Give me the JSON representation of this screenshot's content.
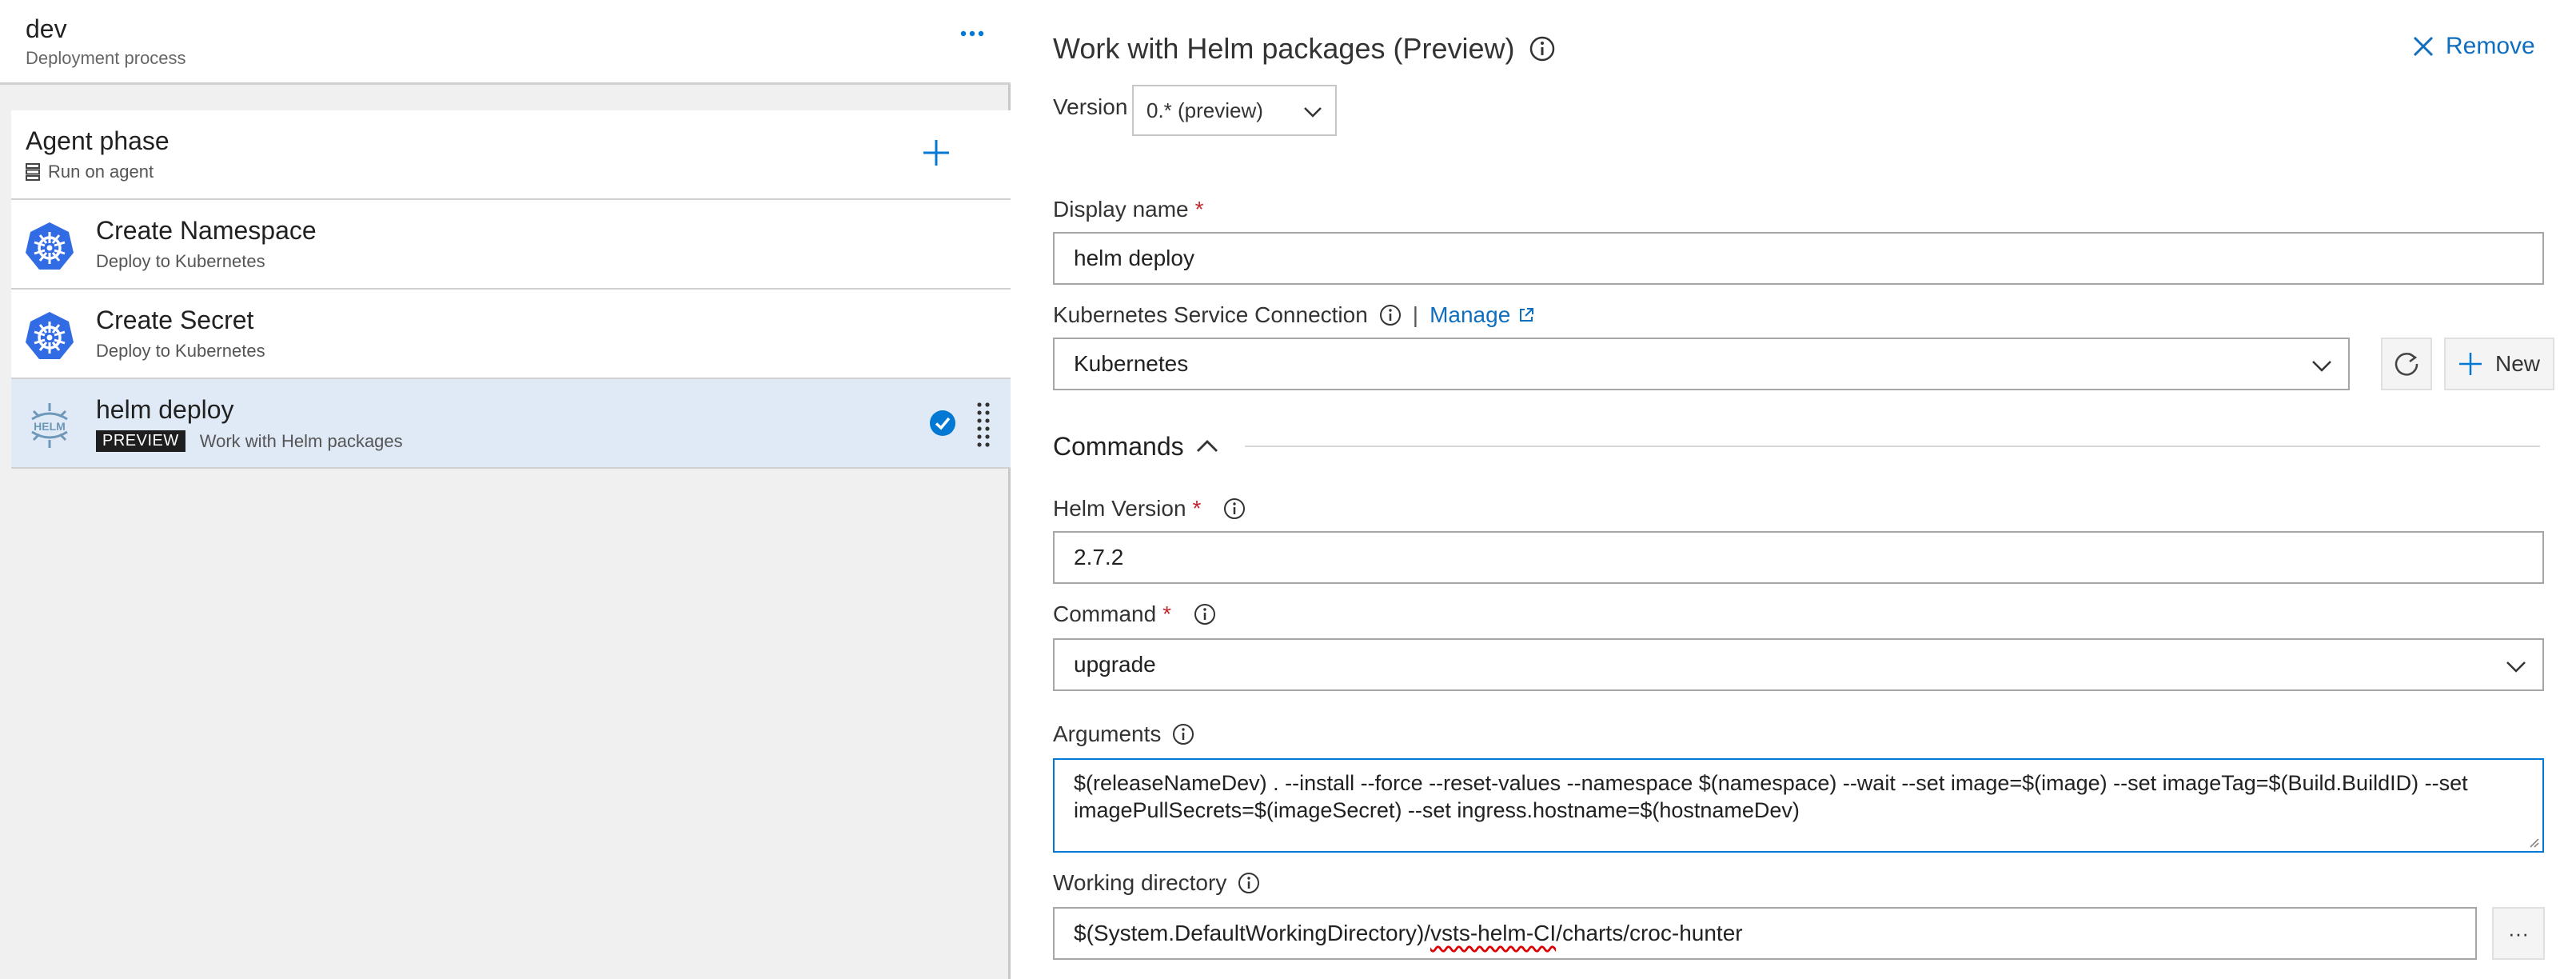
{
  "pipeline": {
    "title": "dev",
    "subtitle": "Deployment process"
  },
  "phase": {
    "title": "Agent phase",
    "subtitle": "Run on agent"
  },
  "tasks": [
    {
      "title": "Create Namespace",
      "subtitle": "Deploy to Kubernetes",
      "icon": "kubernetes-icon"
    },
    {
      "title": "Create Secret",
      "subtitle": "Deploy to Kubernetes",
      "icon": "kubernetes-icon"
    },
    {
      "title": "helm deploy",
      "badge": "PREVIEW",
      "subtitle": "Work with Helm packages",
      "icon": "helm-icon",
      "icon_text": "HELM",
      "selected": true
    }
  ],
  "detail": {
    "title": "Work with Helm packages (Preview)",
    "remove_label": "Remove",
    "version_label": "Version",
    "version_value": "0.* (preview)",
    "display_name_label": "Display name",
    "display_name_required": "*",
    "display_name_value": "helm deploy",
    "k8s_connection_label": "Kubernetes Service Connection",
    "separator": "|",
    "manage_label": "Manage",
    "k8s_connection_value": "Kubernetes",
    "new_label": "New",
    "commands_section": "Commands",
    "helm_version_label": "Helm Version",
    "helm_version_required": "*",
    "helm_version_value": "2.7.2",
    "command_label": "Command",
    "command_required": "*",
    "command_value": "upgrade",
    "arguments_label": "Arguments",
    "arguments_value": "$(releaseNameDev) . --install --force --reset-values --namespace $(namespace) --wait --set image=$(image) --set imageTag=$(Build.BuildID) --set imagePullSecrets=$(imageSecret) --set ingress.hostname=$(hostnameDev)",
    "working_dir_label": "Working directory",
    "working_dir_prefix": "$(System.DefaultWorkingDirectory)/",
    "working_dir_misspelled": "vsts-helm-CI",
    "working_dir_suffix": "/charts/croc-hunter",
    "browse_label": "···"
  },
  "colors": {
    "accent": "#0078d4",
    "link": "#106ebe",
    "required": "#c4262e",
    "selected_row": "#dfeaf6",
    "kubernetes_blue": "#326ce5"
  }
}
